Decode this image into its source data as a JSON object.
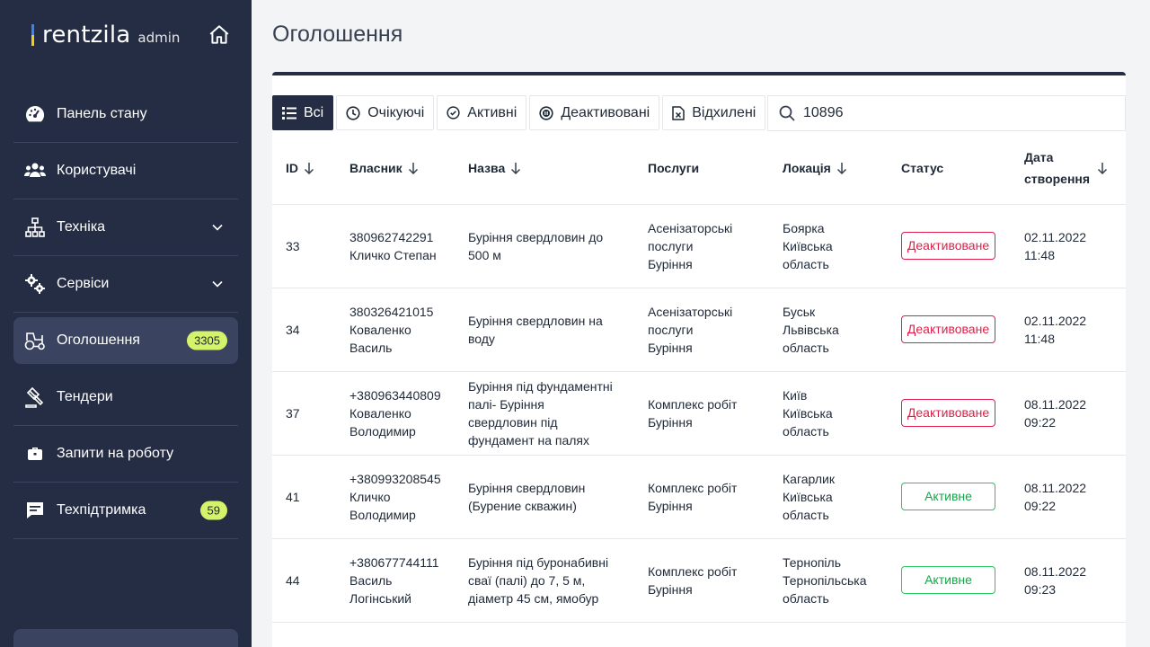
{
  "brand": {
    "name": "rentzila",
    "sub": "admin"
  },
  "sidebar": {
    "items": [
      {
        "label": "Панель стану",
        "icon": "dashboard-icon"
      },
      {
        "label": "Користувачі",
        "icon": "users-icon"
      },
      {
        "label": "Техніка",
        "icon": "hierarchy-icon",
        "expandable": true
      },
      {
        "label": "Сервіси",
        "icon": "gears-icon",
        "expandable": true
      },
      {
        "label": "Оголошення",
        "icon": "tractor-icon",
        "active": true,
        "badge": "3305"
      },
      {
        "label": "Тендери",
        "icon": "gavel-icon"
      },
      {
        "label": "Запити на роботу",
        "icon": "briefcase-icon"
      },
      {
        "label": "Техпідтримка",
        "icon": "chat-icon",
        "badge": "59"
      }
    ]
  },
  "page": {
    "title": "Оголошення"
  },
  "filters": {
    "all": "Всі",
    "pending": "Очікуючі",
    "active": "Активні",
    "deactivated": "Деактивовані",
    "rejected": "Відхилені"
  },
  "search": {
    "value": "10896"
  },
  "table": {
    "headers": {
      "id": "ID",
      "owner": "Власник",
      "name": "Назва",
      "services": "Послуги",
      "location": "Локація",
      "status": "Статус",
      "created_1": "Дата",
      "created_2": "створення"
    },
    "rows": [
      {
        "id": "33",
        "owner": [
          "380962742291",
          "Кличко Степан"
        ],
        "name": [
          "Буріння свердловин до",
          "500 м"
        ],
        "services": [
          "Асенізаторські",
          "послуги",
          "Буріння"
        ],
        "location": [
          "Боярка",
          "Київська",
          "область"
        ],
        "status": "Деактивоване",
        "date": "02.11.2022",
        "time": "11:48"
      },
      {
        "id": "34",
        "owner": [
          "380326421015",
          "Коваленко",
          "Василь"
        ],
        "name": [
          "Буріння свердловин на",
          "воду"
        ],
        "services": [
          "Асенізаторські",
          "послуги",
          "Буріння"
        ],
        "location": [
          "Буськ",
          "Львівська",
          "область"
        ],
        "status": "Деактивоване",
        "date": "02.11.2022",
        "time": "11:48"
      },
      {
        "id": "37",
        "owner": [
          "+380963440809",
          "Коваленко",
          "Володимир"
        ],
        "name": [
          "Буріння під фундаментні",
          "палі- Буріння",
          "свердловин під",
          "фундамент на палях"
        ],
        "services": [
          "Комплекс робіт",
          "Буріння"
        ],
        "location": [
          "Київ",
          "Київська",
          "область"
        ],
        "status": "Деактивоване",
        "date": "08.11.2022",
        "time": "09:22"
      },
      {
        "id": "41",
        "owner": [
          "+380993208545",
          "Кличко",
          "Володимир"
        ],
        "name": [
          "Буріння свердловин",
          "(Бурение скважин)"
        ],
        "services": [
          "Комплекс робіт",
          "Буріння"
        ],
        "location": [
          "Кагарлик",
          "Київська",
          "область"
        ],
        "status": "Активне",
        "date": "08.11.2022",
        "time": "09:22"
      },
      {
        "id": "44",
        "owner": [
          "+380677744111",
          "Василь",
          "Логінський"
        ],
        "name": [
          "Буріння під буронабивні",
          "сваї (палі) до 7, 5 м,",
          "діаметр 45 см, ямобур"
        ],
        "services": [
          "Комплекс робіт",
          "Буріння"
        ],
        "location": [
          "Тернопіль",
          "Тернопільська",
          "область"
        ],
        "status": "Активне",
        "date": "08.11.2022",
        "time": "09:23"
      }
    ]
  },
  "colors": {
    "sidebar_bg": "#252d44",
    "badge": "#d5f36a",
    "deactivated": "#e11d48",
    "active": "#16a34a"
  }
}
